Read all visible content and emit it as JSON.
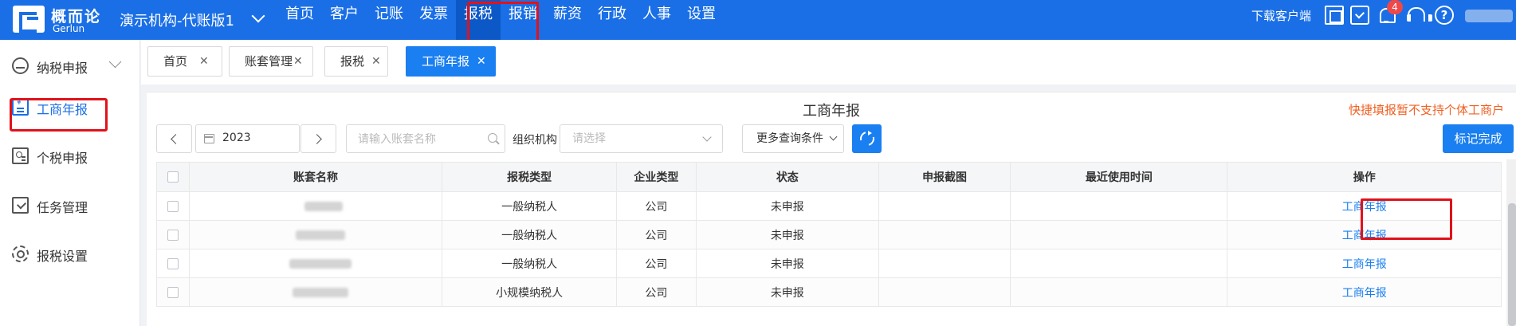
{
  "brand": {
    "name_cn": "概而论",
    "name_en": "Gerlun"
  },
  "org": {
    "name": "演示机构-代账版1"
  },
  "nav": {
    "items": [
      {
        "label": "首页"
      },
      {
        "label": "客户"
      },
      {
        "label": "记账"
      },
      {
        "label": "发票"
      },
      {
        "label": "报税"
      },
      {
        "label": "报销"
      },
      {
        "label": "薪资"
      },
      {
        "label": "行政"
      },
      {
        "label": "人事"
      },
      {
        "label": "设置"
      }
    ],
    "active": "报税"
  },
  "top_right": {
    "download_label": "下载客户端",
    "notification_count": "4",
    "icons": [
      "scan-icon",
      "clipboard-check-icon",
      "bell-icon",
      "headset-icon",
      "help-icon"
    ]
  },
  "sidebar": {
    "items": [
      {
        "label": "纳税申报",
        "icon": "tax-declare-icon",
        "has_submenu": true
      },
      {
        "label": "工商年报",
        "icon": "annual-report-icon",
        "active": true
      },
      {
        "label": "个税申报",
        "icon": "personal-tax-icon"
      },
      {
        "label": "任务管理",
        "icon": "task-icon"
      },
      {
        "label": "报税设置",
        "icon": "gear-icon"
      }
    ]
  },
  "tabs": [
    {
      "label": "首页"
    },
    {
      "label": "账套管理"
    },
    {
      "label": "报税"
    },
    {
      "label": "工商年报",
      "active": true
    }
  ],
  "page": {
    "title": "工商年报",
    "notice": "快捷填报暂不支持个体工商户"
  },
  "filters": {
    "year": "2023",
    "search_placeholder": "请输入账套名称",
    "org_label": "组织机构",
    "org_placeholder": "请选择",
    "more_label": "更多查询条件",
    "mark_done_label": "标记完成"
  },
  "table": {
    "columns": [
      "账套名称",
      "报税类型",
      "企业类型",
      "状态",
      "申报截图",
      "最近使用时间",
      "操作"
    ],
    "rows": [
      {
        "name": "",
        "tax_type": "一般纳税人",
        "company_type": "公司",
        "status": "未申报",
        "screenshot": "",
        "last_used": "",
        "action": "工商年报"
      },
      {
        "name": "",
        "tax_type": "一般纳税人",
        "company_type": "公司",
        "status": "未申报",
        "screenshot": "",
        "last_used": "",
        "action": "工商年报"
      },
      {
        "name": "",
        "tax_type": "一般纳税人",
        "company_type": "公司",
        "status": "未申报",
        "screenshot": "",
        "last_used": "",
        "action": "工商年报"
      },
      {
        "name": "",
        "tax_type": "小规模纳税人",
        "company_type": "公司",
        "status": "未申报",
        "screenshot": "",
        "last_used": "",
        "action": "工商年报"
      }
    ]
  },
  "colors": {
    "primary": "#1a6fe6",
    "button": "#1a7ff0",
    "notice": "#f06023",
    "annotation": "#e0121a"
  }
}
